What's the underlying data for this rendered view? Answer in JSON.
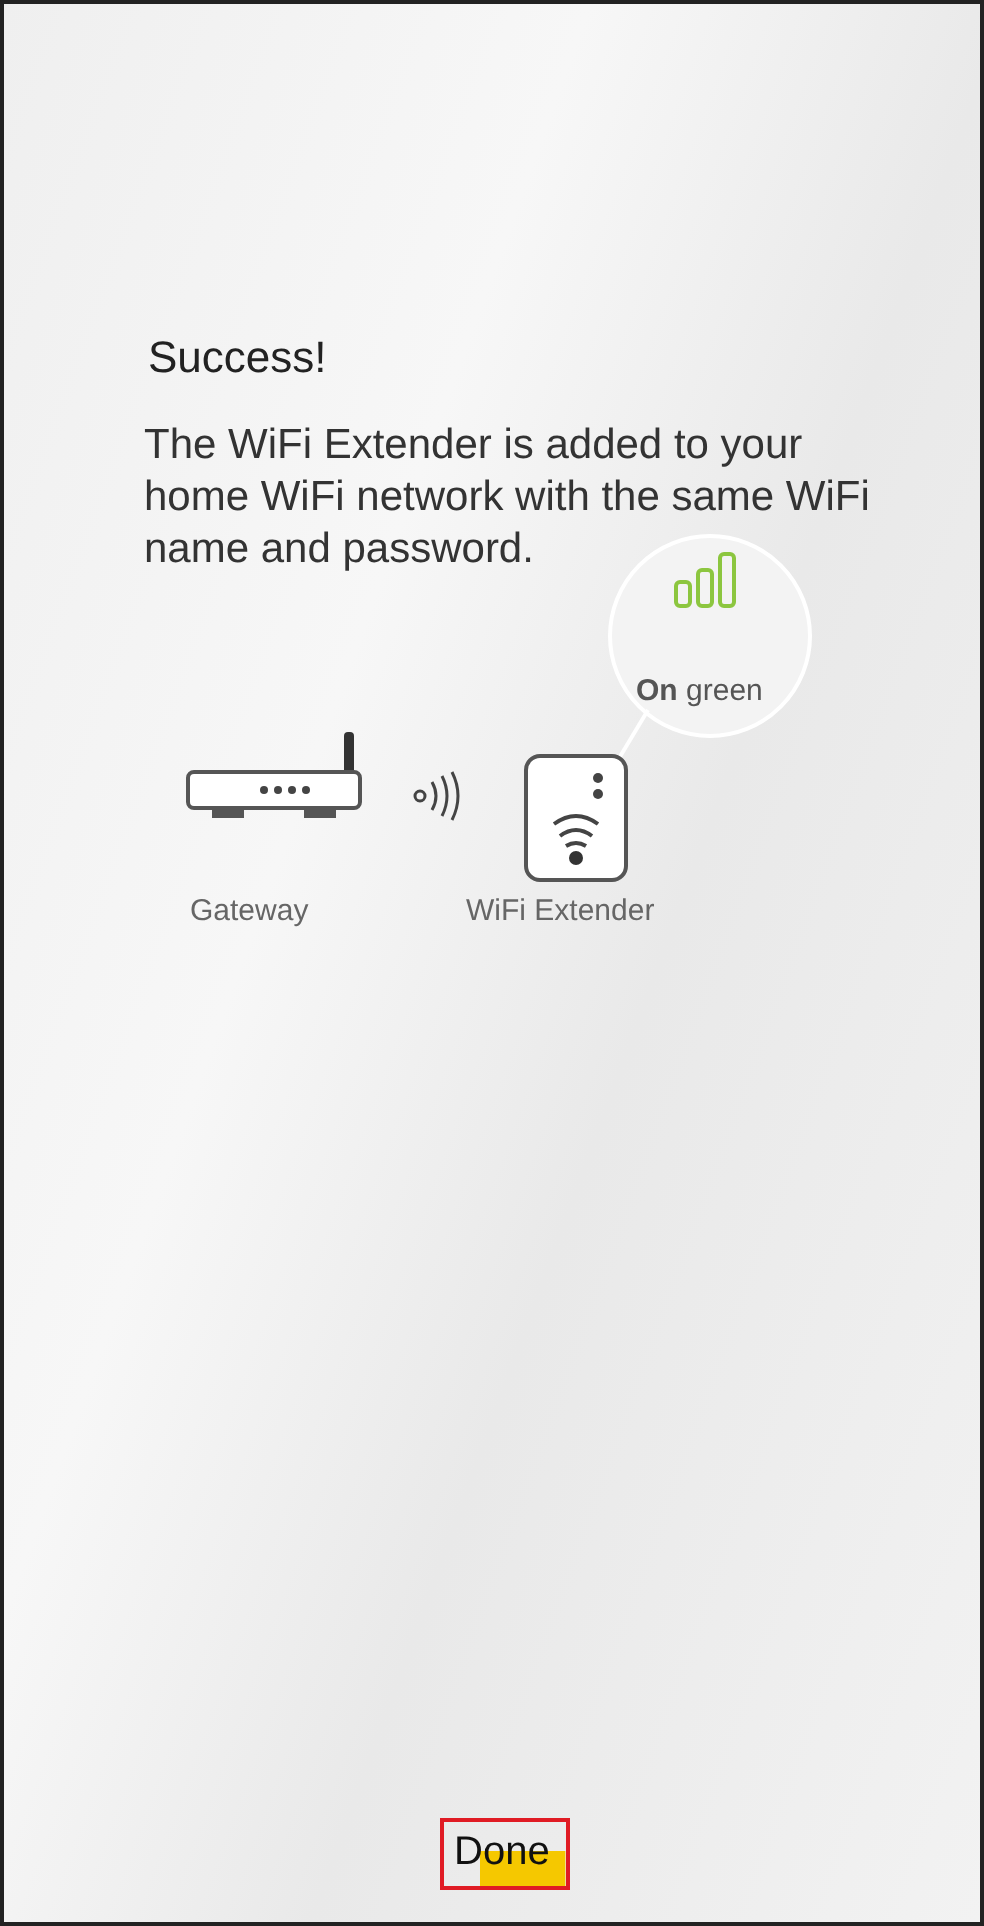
{
  "title": "Success!",
  "message": "The WiFi Extender is added to your home WiFi network with the same WiFi name and password.",
  "diagram": {
    "bubble_label": "**On** green",
    "gateway_label": "Gateway",
    "extender_label": "WiFi Extender"
  },
  "done_button": "Done"
}
